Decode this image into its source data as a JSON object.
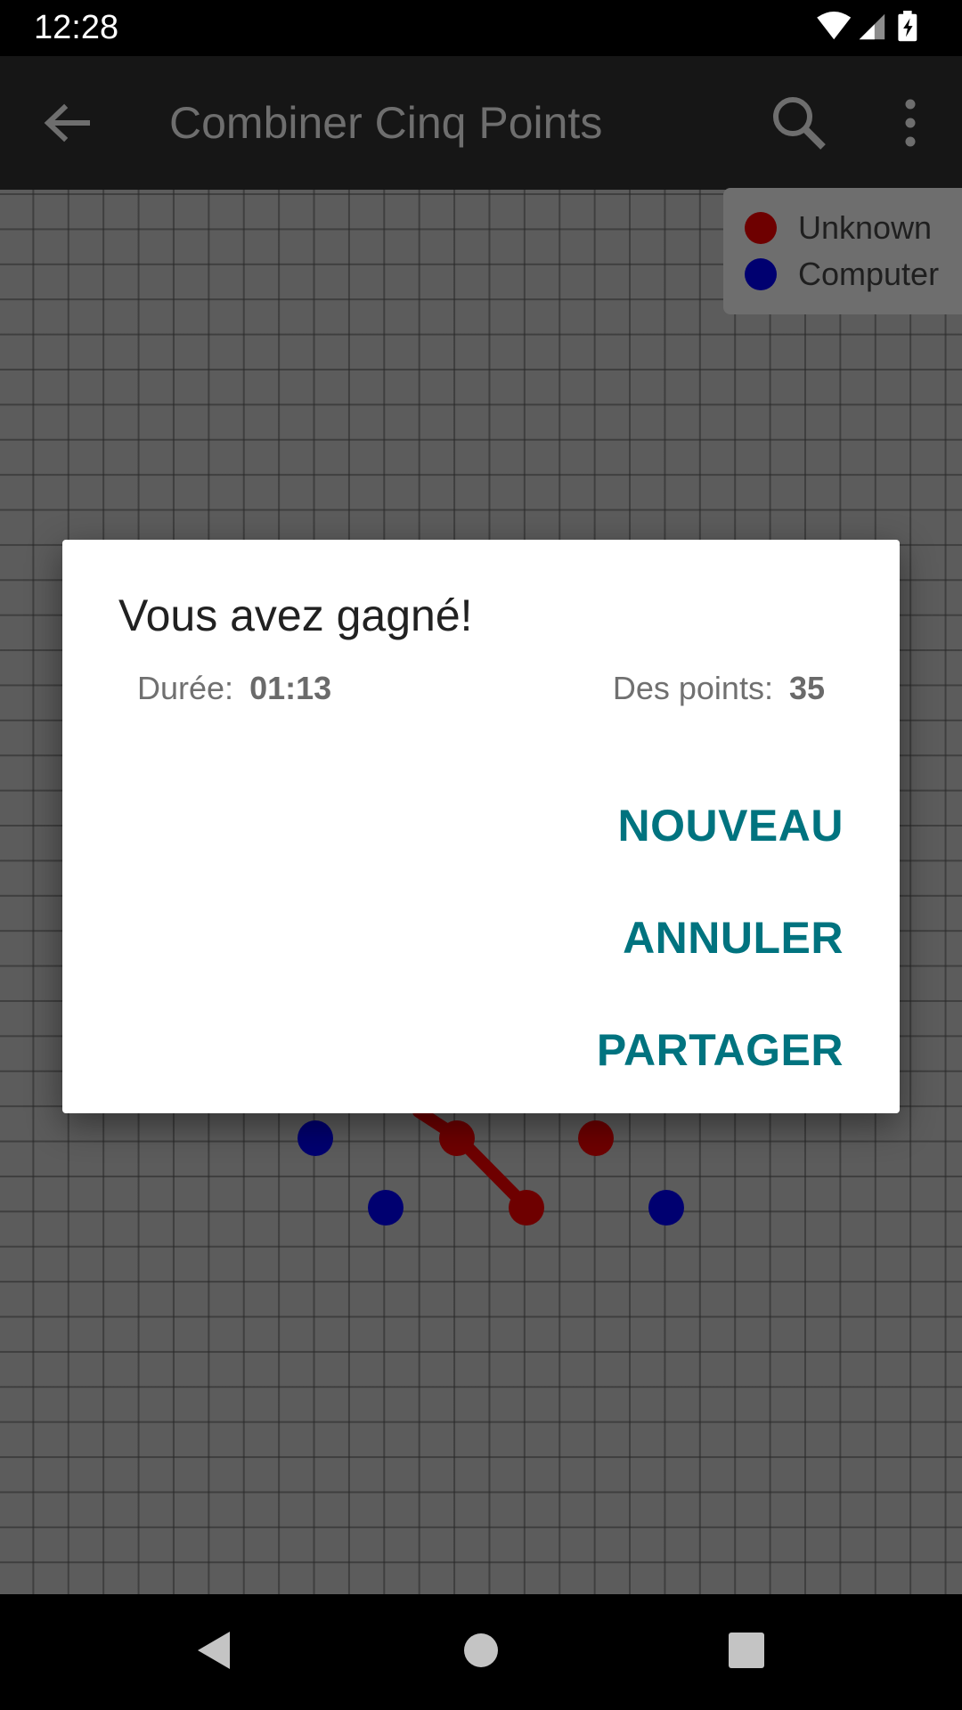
{
  "status_bar": {
    "time": "12:28",
    "icons": [
      "wifi-icon",
      "cell-signal-icon",
      "battery-charging-icon"
    ]
  },
  "app_bar": {
    "title": "Combiner Cinq Points",
    "icons": [
      "back-arrow-icon",
      "search-icon",
      "more-vert-icon"
    ]
  },
  "legend": {
    "items": [
      {
        "label": "Unknown",
        "color": "#8b0000"
      },
      {
        "label": "Computer",
        "color": "#00008b"
      }
    ]
  },
  "board": {
    "red_color": "#6e0000",
    "blue_color": "#000070"
  },
  "dialog": {
    "title": "Vous avez gagné!",
    "duration_label": "Durée:",
    "duration_value": "01:13",
    "points_label": "Des points:",
    "points_value": "35",
    "buttons": {
      "new": "NOUVEAU",
      "cancel": "ANNULER",
      "share": "PARTAGER"
    },
    "accent_color": "#00737f"
  },
  "nav_bar": {
    "icons": [
      "back-triangle-icon",
      "home-circle-icon",
      "recents-square-icon"
    ]
  }
}
